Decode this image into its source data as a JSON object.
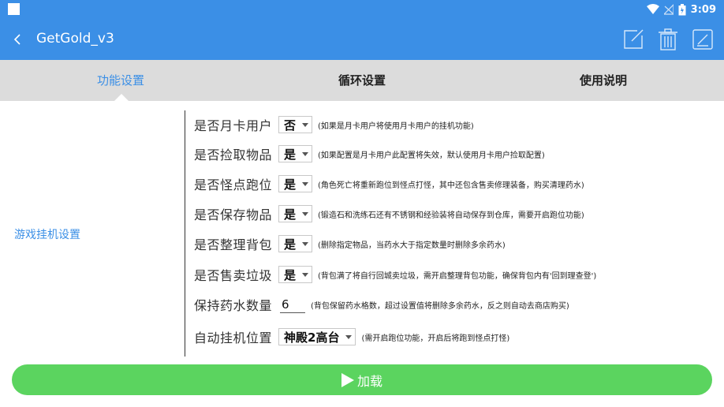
{
  "status_bar": {
    "time": "3:09",
    "icons": [
      "wifi-icon",
      "signal-off-icon",
      "battery-icon"
    ]
  },
  "app_bar": {
    "title": "GetGold_v3",
    "back_icon": "chevron-left-icon",
    "actions": [
      "edit-icon",
      "trash-icon",
      "rename-icon"
    ]
  },
  "tabs": [
    {
      "label": "功能设置",
      "active": true
    },
    {
      "label": "循环设置",
      "active": false
    },
    {
      "label": "使用说明",
      "active": false
    }
  ],
  "side_label": "游戏挂机设置",
  "settings": [
    {
      "label": "是否月卡用户",
      "value": "否",
      "hint": "(如果是月卡用户将使用月卡用户的挂机功能)"
    },
    {
      "label": "是否捡取物品",
      "value": "是",
      "hint": "(如果配置是月卡用户此配置将失效，默认使用月卡用户捡取配置)"
    },
    {
      "label": "是否怪点跑位",
      "value": "是",
      "hint": "(角色死亡将重新跑位到怪点打怪，其中还包含售卖修理装备，购买清理药水)"
    },
    {
      "label": "是否保存物品",
      "value": "是",
      "hint": "(锻造石和洗练石还有不锈钢和经验装将自动保存到仓库，需要开启跑位功能)"
    },
    {
      "label": "是否整理背包",
      "value": "是",
      "hint": "(删除指定物品，当药水大于指定数量时删除多余药水)"
    },
    {
      "label": "是否售卖垃圾",
      "value": "是",
      "hint": "(背包满了将自行回城卖垃圾，需开启整理背包功能，确保背包内有'回到理查登')"
    }
  ],
  "potion": {
    "label": "保持药水数量",
    "value": "6",
    "hint": "(背包保留药水格数，超过设置值将删除多余药水，反之则自动去商店购买)"
  },
  "location": {
    "label": "自动挂机位置",
    "value": "神殿2高台",
    "hint": "(需开启跑位功能，开启后将跑到怪点打怪)"
  },
  "load_button": {
    "label": "加载",
    "icon": "play-icon"
  },
  "colors": {
    "primary": "#3b8fe6",
    "tabbar": "#dcdcdc",
    "load": "#5bd45f"
  }
}
